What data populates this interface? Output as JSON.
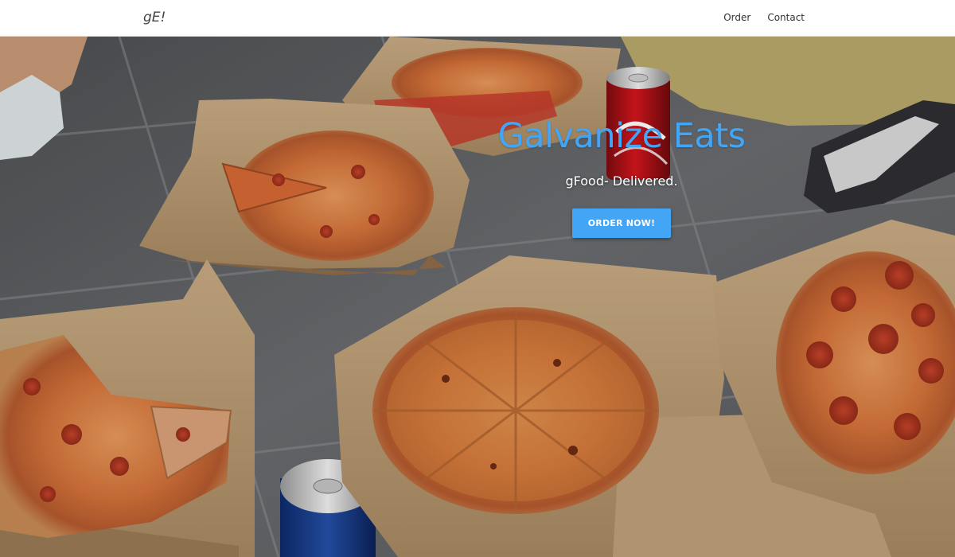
{
  "nav": {
    "brand": "gE!",
    "links": [
      "Order",
      "Contact"
    ]
  },
  "hero": {
    "title": "Galvanize Eats",
    "subtitle": "gFood- Delivered.",
    "cta": "ORDER NOW!",
    "background": "photo of pizzas in open boxes with soda cans on a tiled floor"
  },
  "colors": {
    "accent": "#42a5f5",
    "navbar_bg": "#ffffff",
    "text_white": "#ffffff"
  }
}
